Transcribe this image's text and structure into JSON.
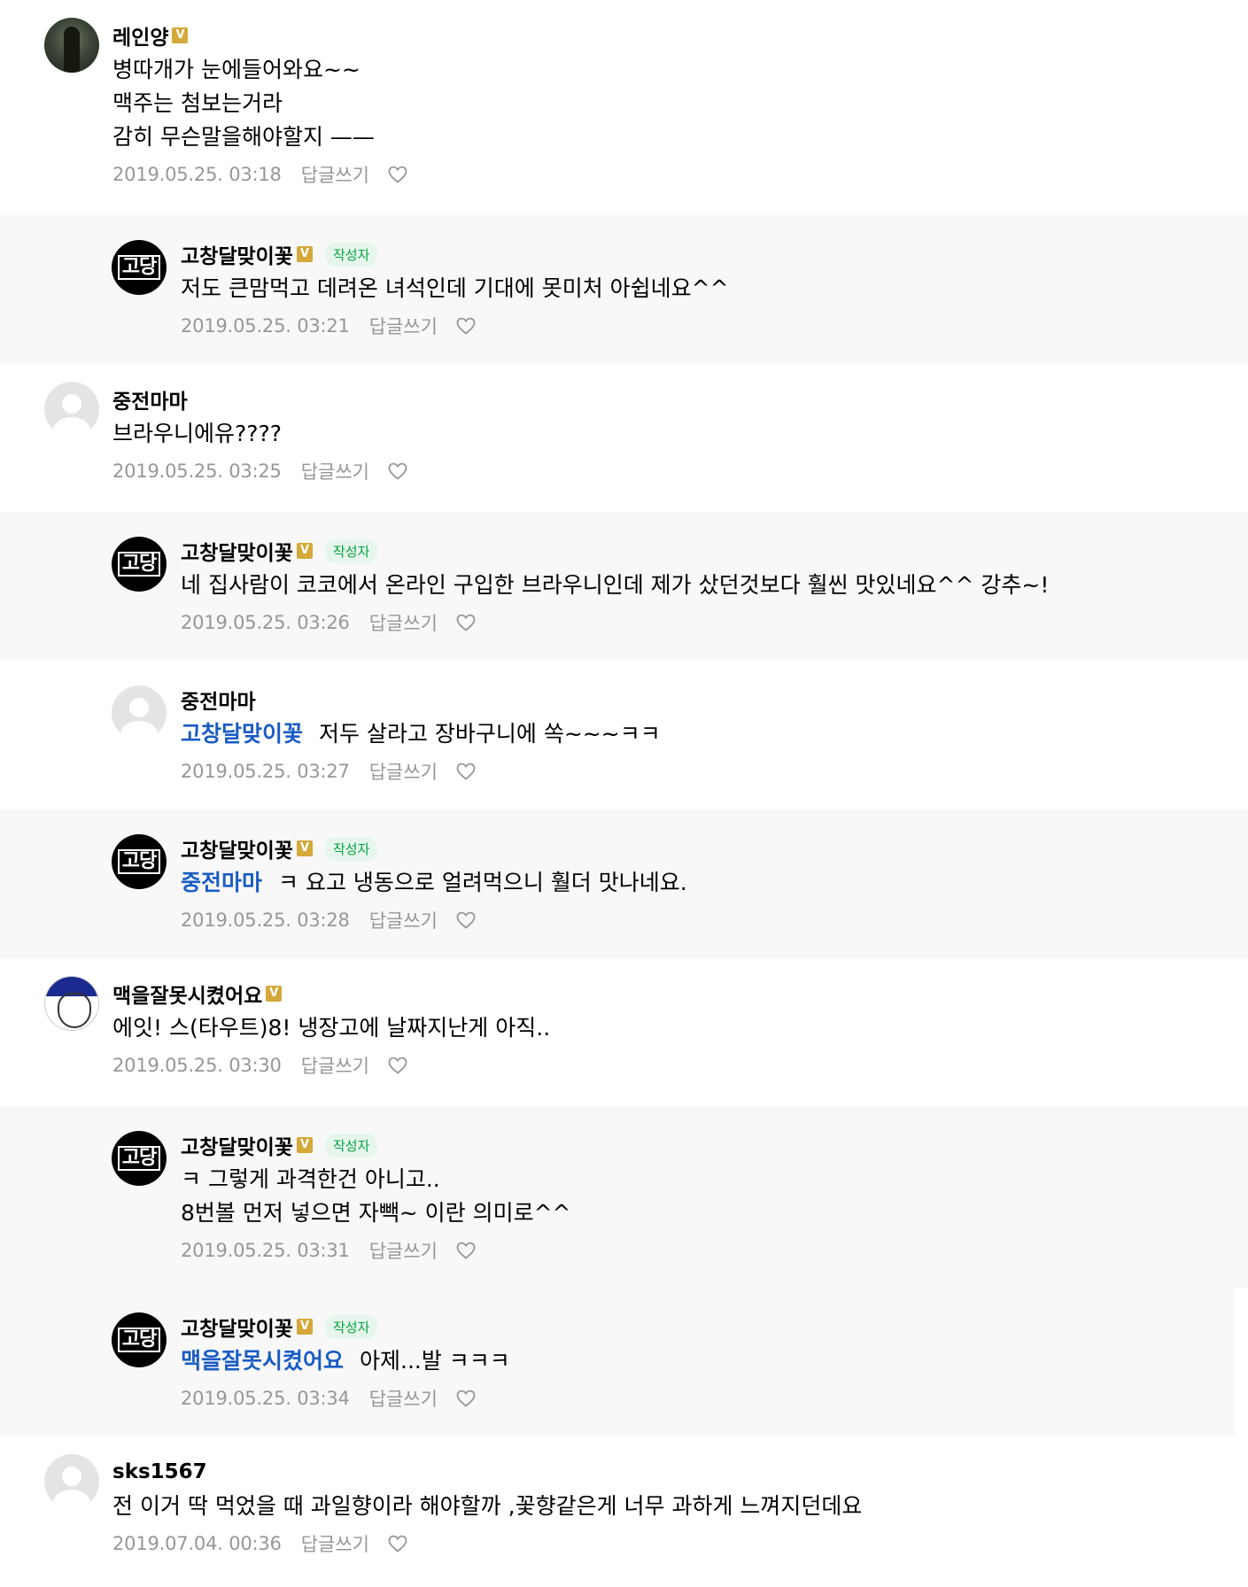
{
  "reply_label": "답글쓰기",
  "author_badge": "작성자",
  "verified_badge": "V",
  "avatar_logo_text": "고당",
  "comments": [
    {
      "nick": "레인양",
      "lines": [
        "병따개가 눈에들어와요~~",
        "맥주는 첨보는거라",
        "감히 무슨말을해야할지 ——"
      ],
      "date": "2019.05.25. 03:18"
    },
    {
      "nick": "고창달맞이꽃",
      "lines": [
        "저도 큰맘먹고 데려온 녀석인데 기대에 못미처 아쉽네요^^"
      ],
      "date": "2019.05.25. 03:21"
    },
    {
      "nick": "중전마마",
      "lines": [
        "브라우니에유????"
      ],
      "date": "2019.05.25. 03:25"
    },
    {
      "nick": "고창달맞이꽃",
      "lines": [
        "네 집사람이 코코에서 온라인 구입한 브라우니인데 제가 샀던것보다 훨씬 맛있네요^^ 강추~!"
      ],
      "date": "2019.05.25. 03:26"
    },
    {
      "nick": "중전마마",
      "mention": "고창달맞이꽃",
      "lines": [
        "저두 살라고 장바구니에 쏙~~~ㅋㅋ"
      ],
      "date": "2019.05.25. 03:27"
    },
    {
      "nick": "고창달맞이꽃",
      "mention": "중전마마",
      "lines": [
        "ㅋ 요고 냉동으로 얼려먹으니 훨더 맛나네요."
      ],
      "date": "2019.05.25. 03:28"
    },
    {
      "nick": "맥을잘못시켰어요",
      "lines": [
        "에잇! 스(타우트)8! 냉장고에 날짜지난게 아직.."
      ],
      "date": "2019.05.25. 03:30"
    },
    {
      "nick": "고창달맞이꽃",
      "lines": [
        "ㅋ 그렇게 과격한건 아니고..",
        "8번볼 먼저 넣으면 자빽~ 이란 의미로^^"
      ],
      "date": "2019.05.25. 03:31"
    },
    {
      "nick": "고창달맞이꽃",
      "mention": "맥을잘못시켰어요",
      "lines": [
        "아제...발 ㅋㅋㅋ"
      ],
      "date": "2019.05.25. 03:34"
    },
    {
      "nick": "sks1567",
      "lines": [
        "전 이거 딱 먹었을 때 과일향이라 해야할까 ,꽃향같은게 너무 과하게 느껴지던데요"
      ],
      "date": "2019.07.04. 00:36"
    }
  ]
}
